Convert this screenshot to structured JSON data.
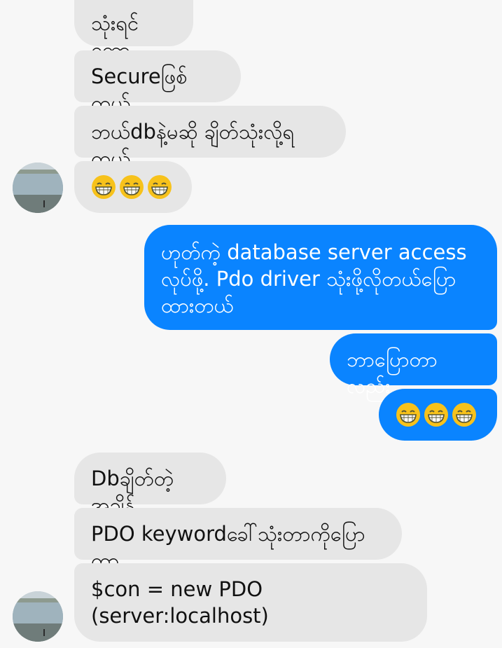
{
  "messages": [
    {
      "side": "in",
      "text": "သုံးရင်တော့"
    },
    {
      "side": "in",
      "text": "Secureဖြစ်တယ်"
    },
    {
      "side": "in",
      "text": "ဘယ်dbနဲ့မဆို ချိတ်သုံးလို့ရတယ်"
    },
    {
      "side": "in",
      "emoji": "grinning-face",
      "count": 3
    },
    {
      "side": "out",
      "text": "ဟုတ်ကဲ့ database server access လုပ်ဖို့. Pdo driver သုံးဖို့လိုတယ်ပြော ထားတယ်"
    },
    {
      "side": "out",
      "text": "ဘာပြောတာလည်း"
    },
    {
      "side": "out",
      "emoji": "grinning-face",
      "count": 3
    },
    {
      "side": "in",
      "text": "Dbချိတ်တဲ့အချိန်"
    },
    {
      "side": "in",
      "text": "PDO keywordခေါ်သုံးတာကိုပြောတာ"
    },
    {
      "side": "in",
      "text": "$con = new PDO (server:localhost)"
    }
  ],
  "colors": {
    "incoming_bubble": "#e6e6e6",
    "outgoing_bubble": "#0a84ff",
    "background": "#f7f7f7"
  }
}
